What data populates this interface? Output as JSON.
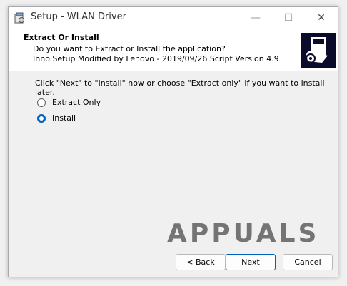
{
  "window": {
    "title": "Setup - WLAN Driver",
    "minimize_glyph": "—",
    "maximize_glyph": "☐",
    "close_glyph": "✕"
  },
  "header": {
    "title": "Extract Or Install",
    "line1": "Do you want to Extract or Install the application?",
    "line2": "Inno Setup Modified by Lenovo - 2019/09/26 Script Version 4.9"
  },
  "content": {
    "instruction": "Click \"Next\" to \"Install\" now or choose \"Extract only\" if you want to install later.",
    "options": [
      {
        "label": "Extract Only",
        "selected": false
      },
      {
        "label": "Install",
        "selected": true
      }
    ]
  },
  "watermark": {
    "text": "APPUALS"
  },
  "buttons": {
    "back": "< Back",
    "next": "Next",
    "cancel": "Cancel"
  },
  "colors": {
    "accent": "#005fb8"
  }
}
